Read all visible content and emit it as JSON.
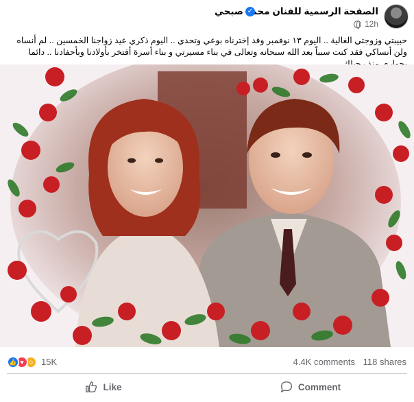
{
  "post": {
    "page_name": "الصفحة الرسمية للفنان محمد صبحي",
    "time": "12h",
    "caption": "حبيبتي وزوجتي الغالية .. اليوم ١٣ نوفمبر وقد إخترناه بوعي وتحدي .. اليوم ذكري عيد زواجنا الخمسين .. لم أنساه ولن أنساكي فقد كنت سبباً بعد الله سبحانه وتعالى في بناء مسيرتي و بناء أسرة أفتخر بأولادنا وبأحفادنا .. دائما بجواري منذ رحيلك"
  },
  "stats": {
    "reactions": "15K",
    "comments": "4.4K comments",
    "shares": "118 shares"
  },
  "actions": {
    "like": "Like",
    "comment": "Comment"
  },
  "icons": {
    "verified": "verified-badge-icon",
    "privacy": "globe-icon",
    "like_reaction": "like-reaction-icon",
    "love_reaction": "love-reaction-icon",
    "care_reaction": "care-reaction-icon",
    "like_action": "thumbs-up-icon",
    "comment_action": "comment-bubble-icon"
  },
  "colors": {
    "accent": "#1877f2",
    "love": "#f33e58",
    "care": "#f7b125",
    "secondary_text": "#65676b"
  }
}
